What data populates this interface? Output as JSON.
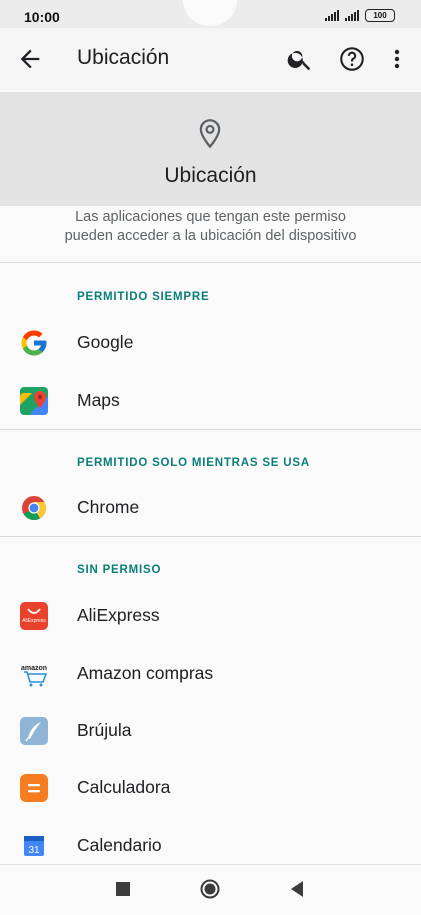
{
  "status_bar": {
    "time": "10:00",
    "battery": "100"
  },
  "app_bar": {
    "title": "Ubicación"
  },
  "header": {
    "title": "Ubicación",
    "description_line1": "Las aplicaciones que tengan este permiso",
    "description_line2": "pueden acceder a la ubicación del dispositivo"
  },
  "sections": [
    {
      "label": "PERMITIDO SIEMPRE",
      "apps": [
        {
          "name": "Google",
          "icon": "google-icon"
        },
        {
          "name": "Maps",
          "icon": "maps-icon"
        }
      ]
    },
    {
      "label": "PERMITIDO SOLO MIENTRAS SE USA",
      "apps": [
        {
          "name": "Chrome",
          "icon": "chrome-icon"
        }
      ]
    },
    {
      "label": "SIN PERMISO",
      "apps": [
        {
          "name": "AliExpress",
          "icon": "aliexpress-icon"
        },
        {
          "name": "Amazon compras",
          "icon": "amazon-icon"
        },
        {
          "name": "Brújula",
          "icon": "compass-icon"
        },
        {
          "name": "Calculadora",
          "icon": "calculator-icon"
        },
        {
          "name": "Calendario",
          "icon": "calendar-icon"
        }
      ]
    }
  ],
  "icon_text": {
    "aliexpress": "AliExpress",
    "amazon": "amazon",
    "calendar_day": "31"
  },
  "colors": {
    "accent": "#0a7f7a",
    "header_bg": "#e3e3e3"
  }
}
